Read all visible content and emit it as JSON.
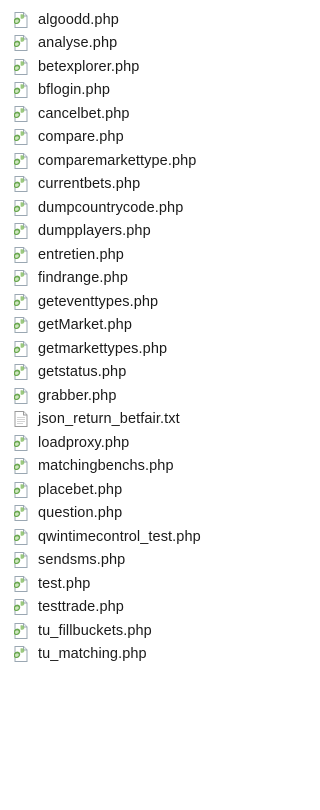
{
  "files": [
    {
      "name": "algoodd.php",
      "icon": "php-file-icon"
    },
    {
      "name": "analyse.php",
      "icon": "php-file-icon"
    },
    {
      "name": "betexplorer.php",
      "icon": "php-file-icon"
    },
    {
      "name": "bflogin.php",
      "icon": "php-file-icon"
    },
    {
      "name": "cancelbet.php",
      "icon": "php-file-icon"
    },
    {
      "name": "compare.php",
      "icon": "php-file-icon"
    },
    {
      "name": "comparemarkettype.php",
      "icon": "php-file-icon"
    },
    {
      "name": "currentbets.php",
      "icon": "php-file-icon"
    },
    {
      "name": "dumpcountrycode.php",
      "icon": "php-file-icon"
    },
    {
      "name": "dumpplayers.php",
      "icon": "php-file-icon"
    },
    {
      "name": "entretien.php",
      "icon": "php-file-icon"
    },
    {
      "name": "findrange.php",
      "icon": "php-file-icon"
    },
    {
      "name": "geteventtypes.php",
      "icon": "php-file-icon"
    },
    {
      "name": "getMarket.php",
      "icon": "php-file-icon"
    },
    {
      "name": "getmarkettypes.php",
      "icon": "php-file-icon"
    },
    {
      "name": "getstatus.php",
      "icon": "php-file-icon"
    },
    {
      "name": "grabber.php",
      "icon": "php-file-icon"
    },
    {
      "name": "json_return_betfair.txt",
      "icon": "text-file-icon"
    },
    {
      "name": "loadproxy.php",
      "icon": "php-file-icon"
    },
    {
      "name": "matchingbenchs.php",
      "icon": "php-file-icon"
    },
    {
      "name": "placebet.php",
      "icon": "php-file-icon"
    },
    {
      "name": "question.php",
      "icon": "php-file-icon"
    },
    {
      "name": "qwintimecontrol_test.php",
      "icon": "php-file-icon"
    },
    {
      "name": "sendsms.php",
      "icon": "php-file-icon"
    },
    {
      "name": "test.php",
      "icon": "php-file-icon"
    },
    {
      "name": "testtrade.php",
      "icon": "php-file-icon"
    },
    {
      "name": "tu_fillbuckets.php",
      "icon": "php-file-icon"
    },
    {
      "name": "tu_matching.php",
      "icon": "php-file-icon"
    }
  ],
  "colors": {
    "text": "#1a1a1a",
    "php_icon_green": "#6aa84f",
    "php_icon_light": "#cfe6c0",
    "text_icon_border": "#9a9a9a"
  }
}
